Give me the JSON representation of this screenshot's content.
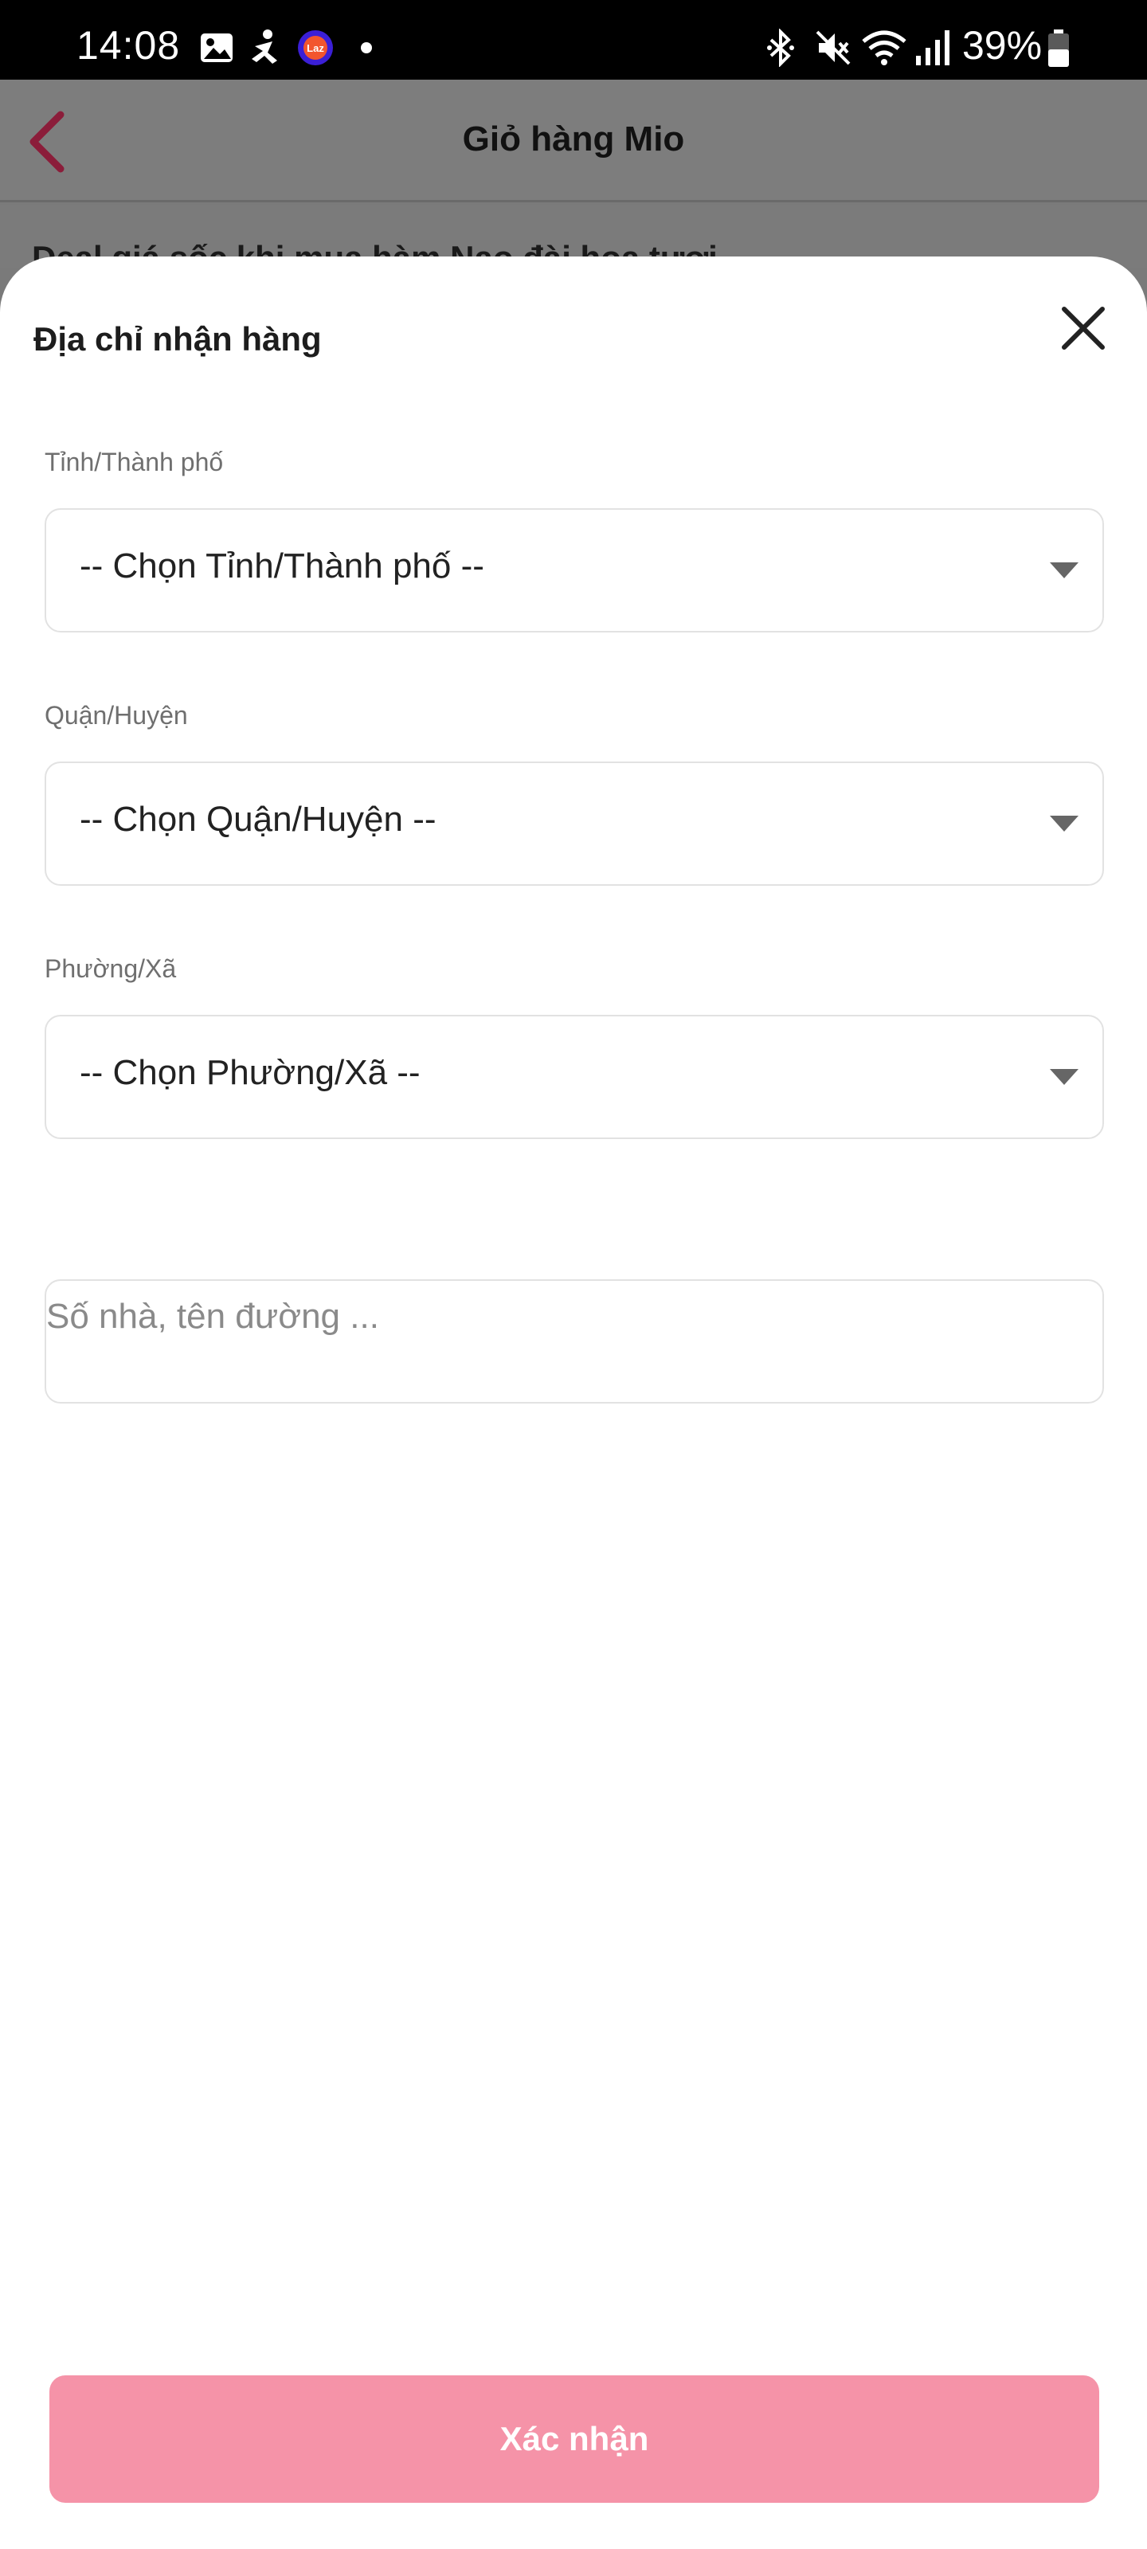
{
  "status_bar": {
    "time": "14:08",
    "battery": "39%",
    "icons": [
      "gallery-icon",
      "accessibility-icon",
      "lazada-icon",
      "dot-icon",
      "bluetooth-icon",
      "mute-icon",
      "wifi-icon",
      "signal-icon",
      "battery-icon"
    ]
  },
  "header": {
    "title": "Giỏ hàng Mio",
    "background_text": "Deal giá sốc khi mua hàm Nạo đài hoa tươi"
  },
  "sheet": {
    "title": "Địa chỉ nhận hàng",
    "province": {
      "label": "Tỉnh/Thành phố",
      "value": "-- Chọn Tỉnh/Thành phố --"
    },
    "district": {
      "label": "Quận/Huyện",
      "value": "-- Chọn Quận/Huyện --"
    },
    "ward": {
      "label": "Phường/Xã",
      "value": "-- Chọn Phường/Xã --"
    },
    "street": {
      "placeholder": "Số nhà, tên đường ...",
      "value": ""
    },
    "confirm_label": "Xác nhận"
  },
  "colors": {
    "accent": "#9c1a3e",
    "confirm_button": "#f593a8",
    "status_bar": "#000000"
  }
}
